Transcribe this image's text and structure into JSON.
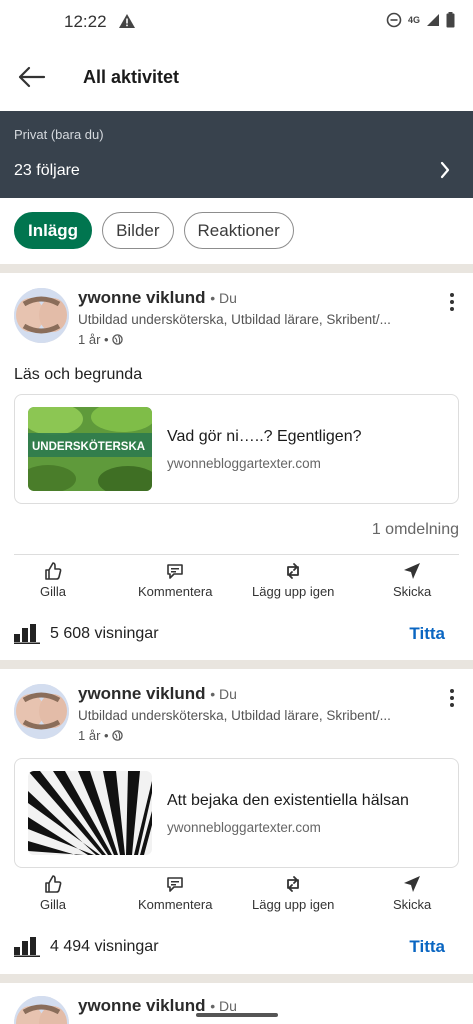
{
  "status": {
    "time": "12:22",
    "network": "4G"
  },
  "appbar": {
    "title": "All aktivitet"
  },
  "privacy": {
    "label": "Privat (bara du)",
    "followers": "23 följare"
  },
  "filters": [
    {
      "label": "Inlägg",
      "active": true
    },
    {
      "label": "Bilder",
      "active": false
    },
    {
      "label": "Reaktioner",
      "active": false
    }
  ],
  "posts": [
    {
      "author": "ywonne viklund",
      "badge": "• Du",
      "headline": "Utbildad undersköterska, Utbildad lärare, Skribent/...",
      "age": "1 år •",
      "text": "Läs och begrunda",
      "link_title": "Vad gör ni…..? Egentligen?",
      "link_domain": "ywonnebloggartexter.com",
      "thumb_text": "UNDERSKÖTERSKA",
      "shares": "1 omdelning",
      "views": "5 608 visningar"
    },
    {
      "author": "ywonne viklund",
      "badge": "• Du",
      "headline": "Utbildad undersköterska, Utbildad lärare, Skribent/...",
      "age": "1 år •",
      "link_title": "Att bejaka den existentiella hälsan",
      "link_domain": "ywonnebloggartexter.com",
      "views": "4 494 visningar"
    },
    {
      "author": "ywonne viklund",
      "badge": "• Du"
    }
  ],
  "actions": {
    "like": "Gilla",
    "comment": "Kommentera",
    "repost": "Lägg upp igen",
    "send": "Skicka"
  },
  "view_button": "Titta",
  "colors": {
    "brand_green": "#01754f",
    "link_blue": "#0a66c2",
    "banner": "#38424d",
    "divider": "#e9e5df"
  }
}
